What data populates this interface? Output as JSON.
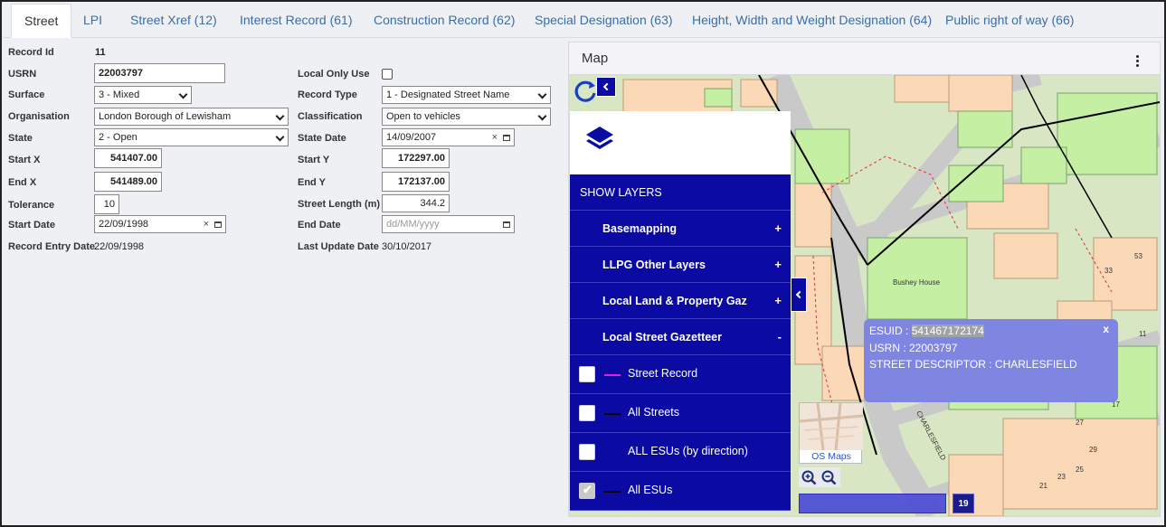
{
  "tabs": [
    {
      "label": "Street",
      "active": true
    },
    {
      "label": "LPI"
    },
    {
      "label": "Street Xref (12)"
    },
    {
      "label": "Interest Record (61)"
    },
    {
      "label": "Construction Record (62)"
    },
    {
      "label": "Special Designation (63)"
    },
    {
      "label": "Height, Width and Weight Designation (64)"
    },
    {
      "label": "Public right of way (66)"
    }
  ],
  "form": {
    "record_id": {
      "label": "Record Id",
      "value": "11"
    },
    "usrn": {
      "label": "USRN",
      "value": "22003797"
    },
    "surface": {
      "label": "Surface",
      "value": "3 - Mixed"
    },
    "organisation": {
      "label": "Organisation",
      "value": "London Borough of Lewisham"
    },
    "state": {
      "label": "State",
      "value": "2 - Open"
    },
    "start_x": {
      "label": "Start X",
      "value": "541407.00"
    },
    "end_x": {
      "label": "End X",
      "value": "541489.00"
    },
    "tolerance": {
      "label": "Tolerance",
      "value": "10"
    },
    "start_date": {
      "label": "Start Date",
      "value": "22/09/1998"
    },
    "record_entry_date": {
      "label": "Record Entry Date",
      "value": "22/09/1998"
    },
    "local_only_use": {
      "label": "Local Only Use",
      "checked": false
    },
    "record_type": {
      "label": "Record Type",
      "value": "1 - Designated Street Name"
    },
    "classification": {
      "label": "Classification",
      "value": "Open to vehicles"
    },
    "state_date": {
      "label": "State Date",
      "value": "14/09/2007"
    },
    "start_y": {
      "label": "Start Y",
      "value": "172297.00"
    },
    "end_y": {
      "label": "End Y",
      "value": "172137.00"
    },
    "street_length": {
      "label": "Street Length (m)",
      "value": "344.2"
    },
    "end_date": {
      "label": "End Date",
      "placeholder": "dd/MM/yyyy"
    },
    "last_update_date": {
      "label": "Last Update Date",
      "value": "30/10/2017"
    },
    "clear_glyph": "×"
  },
  "map": {
    "title": "Map",
    "layers_heading": "SHOW LAYERS",
    "groups": [
      {
        "label": "Basemapping",
        "toggle": "+"
      },
      {
        "label": "LLPG Other Layers",
        "toggle": "+"
      },
      {
        "label": "Local Land & Property Gaz",
        "toggle": "+"
      },
      {
        "label": "Local Street Gazetteer",
        "toggle": "-"
      }
    ],
    "layer_items": [
      {
        "label": "Street Record",
        "checked": false,
        "swatch": "#e020e0"
      },
      {
        "label": "All Streets",
        "checked": false,
        "swatch": "#000000"
      },
      {
        "label": "ALL ESUs (by direction)",
        "checked": false,
        "swatch": ""
      },
      {
        "label": "All ESUs",
        "checked": true,
        "swatch": "#000000"
      }
    ],
    "check_glyph": "✔",
    "popup": {
      "esuid_label": "ESUID :",
      "esuid_value": "541467172174",
      "usrn_line": "USRN : 22003797",
      "descriptor_line": "STREET DESCRIPTOR : CHARLESFIELD",
      "close_label": "x"
    },
    "os_maps_label": "OS Maps",
    "scale_badge": "19",
    "labels": {
      "bushey_house": "Bushey House",
      "street_name": "CHARLESFIELD",
      "house_numbers": [
        "53",
        "33",
        "11",
        "27",
        "29",
        "17",
        "21",
        "23",
        "25"
      ]
    },
    "colors": {
      "panel": "#0b0ba3",
      "popup": "#7f86e2",
      "green": "#c5f0a4",
      "orange": "#fbd9b6",
      "road": "#c9c9c9"
    }
  }
}
